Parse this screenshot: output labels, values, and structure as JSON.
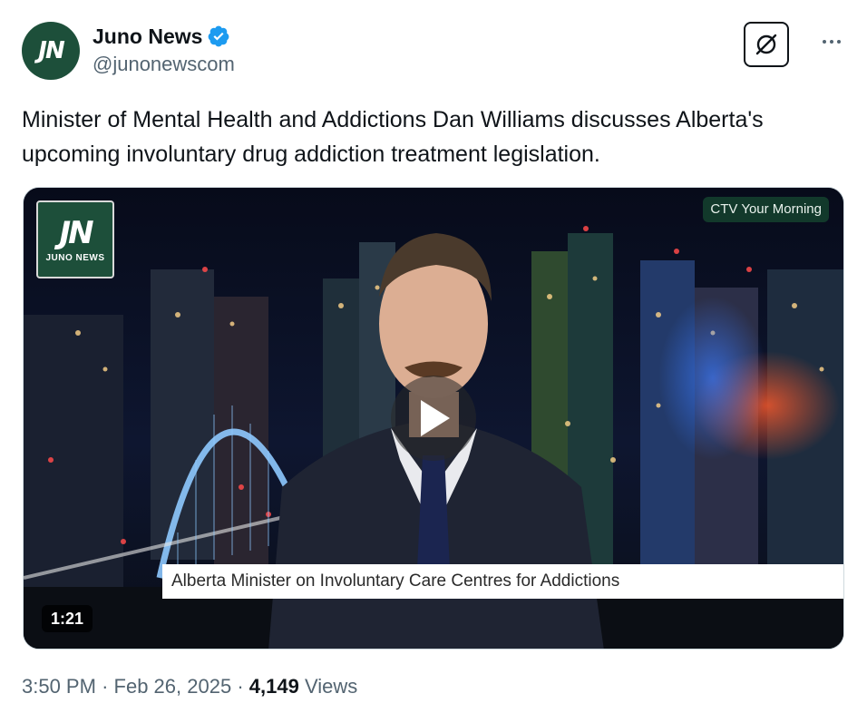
{
  "author": {
    "display_name": "Juno News",
    "handle": "@junonewscom",
    "avatar_text": "JN",
    "verified": true
  },
  "tweet": {
    "text": "Minister of Mental Health and Addictions Dan Williams discusses Alberta's upcoming involuntary drug addiction treatment legislation."
  },
  "media": {
    "logo_mark": "JN",
    "logo_word": "JUNO NEWS",
    "channel_badge": "CTV Your Morning",
    "lower_third": "Alberta Minister on Involuntary Care Centres for Addictions",
    "duration": "1:21"
  },
  "meta": {
    "time": "3:50 PM",
    "separator": "·",
    "date": "Feb 26, 2025",
    "views_count": "4,149",
    "views_label": "Views"
  },
  "colors": {
    "brand_green": "#1d4f3a",
    "verified_blue": "#1d9bf0",
    "secondary_text": "#536471"
  },
  "icons": {
    "verified": "verified-badge-icon",
    "grok": "grok-icon",
    "more": "more-dots-icon",
    "play": "play-icon"
  }
}
